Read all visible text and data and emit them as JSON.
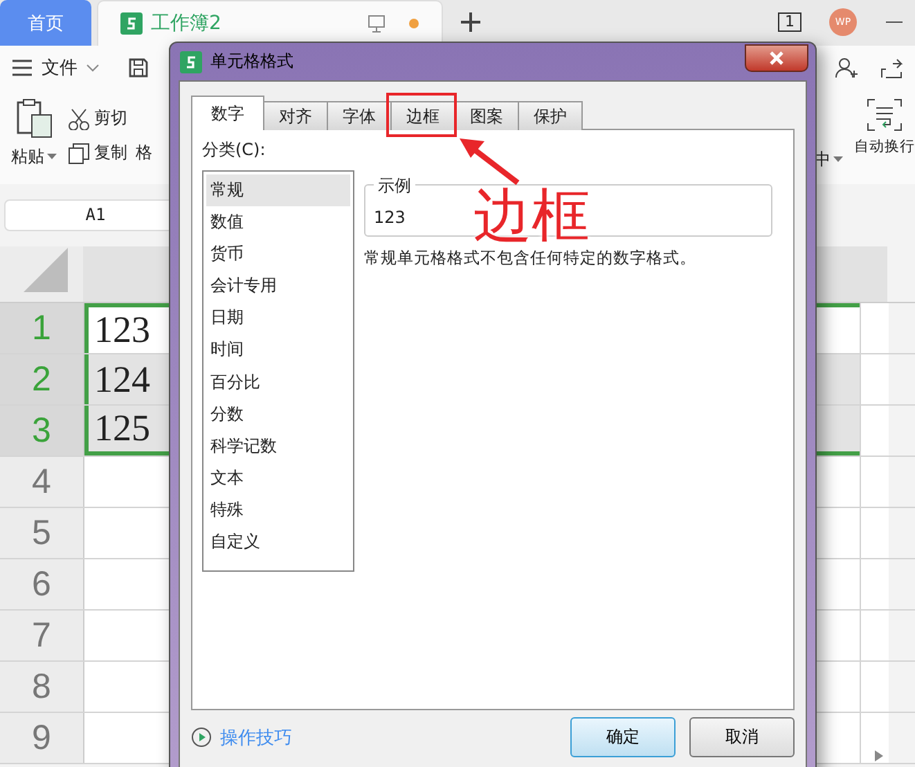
{
  "app_tabs": [
    {
      "label": "首页",
      "selected": false
    },
    {
      "label": "工作簿2",
      "selected": true
    }
  ],
  "window_count": "1",
  "avatar": "WP",
  "menu": {
    "file": "文件"
  },
  "ribbon": {
    "paste": "粘贴",
    "tools": [
      "剪切",
      "复制",
      "格"
    ],
    "right": [
      "中",
      "自动换行"
    ]
  },
  "name_box": "A1",
  "rows": [
    {
      "label": "1",
      "value": "123",
      "selected": true,
      "active": true
    },
    {
      "label": "2",
      "value": "124",
      "selected": true,
      "active": false
    },
    {
      "label": "3",
      "value": "125",
      "selected": true,
      "active": false
    },
    {
      "label": "4",
      "selected": false,
      "active": false
    },
    {
      "label": "5",
      "selected": false,
      "active": false
    },
    {
      "label": "6",
      "selected": false,
      "active": false
    },
    {
      "label": "7",
      "selected": false,
      "active": false
    },
    {
      "label": "8",
      "selected": false,
      "active": false
    },
    {
      "label": "9",
      "selected": false,
      "active": false
    }
  ],
  "dialog": {
    "title": "单元格格式",
    "tabs": [
      {
        "label": "数字",
        "selected": true
      },
      {
        "label": "对齐",
        "selected": false
      },
      {
        "label": "字体",
        "selected": false
      },
      {
        "label": "边框",
        "selected": false,
        "highlighted": true
      },
      {
        "label": "图案",
        "selected": false
      },
      {
        "label": "保护",
        "selected": false
      }
    ],
    "category_label": "分类(C):",
    "categories": [
      {
        "label": "常规",
        "selected": true
      },
      {
        "label": "数值",
        "selected": false
      },
      {
        "label": "货币",
        "selected": false
      },
      {
        "label": "会计专用",
        "selected": false
      },
      {
        "label": "日期",
        "selected": false
      },
      {
        "label": "时间",
        "selected": false
      },
      {
        "label": "百分比",
        "selected": false
      },
      {
        "label": "分数",
        "selected": false
      },
      {
        "label": "科学记数",
        "selected": false
      },
      {
        "label": "文本",
        "selected": false
      },
      {
        "label": "特殊",
        "selected": false
      },
      {
        "label": "自定义",
        "selected": false
      }
    ],
    "sample_label": "示例",
    "sample": "123",
    "description": "常规单元格格式不包含任何特定的数字格式。",
    "tips": "操作技巧",
    "buttons": [
      {
        "label": "确定",
        "kind": "default"
      },
      {
        "label": "取消",
        "kind": "normal"
      }
    ]
  },
  "annotation": {
    "text": "边框"
  }
}
